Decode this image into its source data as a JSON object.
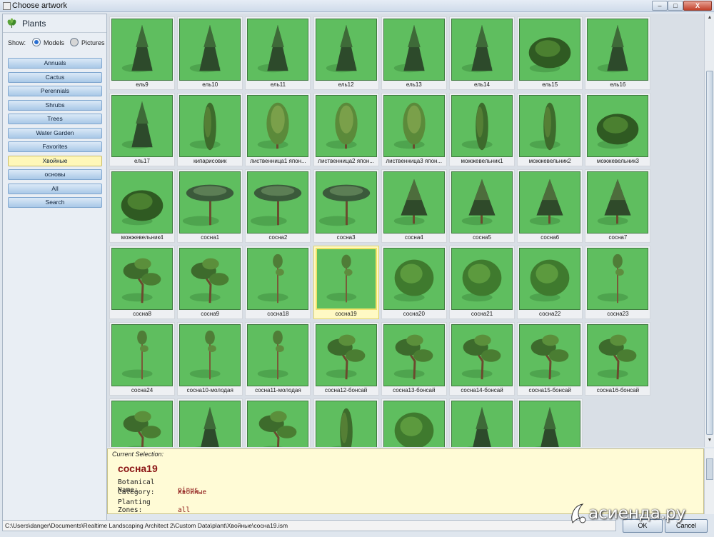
{
  "window": {
    "title": "Choose artwork"
  },
  "titlebar": {
    "minimize": "–",
    "maximize": "□",
    "close": "X"
  },
  "sidebar": {
    "title": "Plants",
    "show_label": "Show:",
    "models_label": "Models",
    "pictures_label": "Pictures",
    "categories": [
      {
        "label": "Annuals"
      },
      {
        "label": "Cactus"
      },
      {
        "label": "Perennials"
      },
      {
        "label": "Shrubs"
      },
      {
        "label": "Trees"
      },
      {
        "label": "Water Garden"
      },
      {
        "label": "Favorites"
      },
      {
        "label": "Хвойные"
      },
      {
        "label": "основы"
      },
      {
        "label": "All"
      },
      {
        "label": "Search"
      }
    ]
  },
  "grid": {
    "items": [
      {
        "label": "ель9",
        "kind": "spruce"
      },
      {
        "label": "ель10",
        "kind": "spruce"
      },
      {
        "label": "ель11",
        "kind": "spruce"
      },
      {
        "label": "ель12",
        "kind": "spruce"
      },
      {
        "label": "ель13",
        "kind": "spruce"
      },
      {
        "label": "ель14",
        "kind": "spruce"
      },
      {
        "label": "ель15",
        "kind": "shrub"
      },
      {
        "label": "ель16",
        "kind": "spruce"
      },
      {
        "label": "ель17",
        "kind": "spruce"
      },
      {
        "label": "кипарисовик",
        "kind": "column"
      },
      {
        "label": "лиственница1 япон...",
        "kind": "weeping"
      },
      {
        "label": "лиственница2 япон...",
        "kind": "weeping"
      },
      {
        "label": "лиственница3 япон...",
        "kind": "weeping"
      },
      {
        "label": "можжевельник1",
        "kind": "column"
      },
      {
        "label": "можжевельник2",
        "kind": "column"
      },
      {
        "label": "можжевельник3",
        "kind": "shrub"
      },
      {
        "label": "можжевельник4",
        "kind": "shrub"
      },
      {
        "label": "сосна1",
        "kind": "umbrella"
      },
      {
        "label": "сосна2",
        "kind": "umbrella"
      },
      {
        "label": "сосна3",
        "kind": "umbrella"
      },
      {
        "label": "сосна4",
        "kind": "cone"
      },
      {
        "label": "сосна5",
        "kind": "cone"
      },
      {
        "label": "сосна6",
        "kind": "cone"
      },
      {
        "label": "сосна7",
        "kind": "cone"
      },
      {
        "label": "сосна8",
        "kind": "bonsai"
      },
      {
        "label": "сосна9",
        "kind": "bonsai"
      },
      {
        "label": "сосна18",
        "kind": "tall"
      },
      {
        "label": "сосна19",
        "kind": "tall"
      },
      {
        "label": "сосна20",
        "kind": "round"
      },
      {
        "label": "сосна21",
        "kind": "round"
      },
      {
        "label": "сосна22",
        "kind": "round"
      },
      {
        "label": "сосна23",
        "kind": "tall"
      },
      {
        "label": "сосна24",
        "kind": "tall"
      },
      {
        "label": "сосна10-молодая",
        "kind": "tall"
      },
      {
        "label": "сосна11-молодая",
        "kind": "tall"
      },
      {
        "label": "сосна12-бонсай",
        "kind": "bonsai"
      },
      {
        "label": "сосна13-бонсай",
        "kind": "bonsai"
      },
      {
        "label": "сосна14-бонсай",
        "kind": "bonsai"
      },
      {
        "label": "сосна15-бонсай",
        "kind": "bonsai"
      },
      {
        "label": "сосна16-бонсай",
        "kind": "bonsai"
      },
      {
        "label": "",
        "kind": "bonsai"
      },
      {
        "label": "",
        "kind": "spruce"
      },
      {
        "label": "",
        "kind": "bonsai"
      },
      {
        "label": "",
        "kind": "column"
      },
      {
        "label": "",
        "kind": "round"
      },
      {
        "label": "",
        "kind": "spruce"
      },
      {
        "label": "",
        "kind": "spruce"
      }
    ],
    "selected_label": "сосна19"
  },
  "details": {
    "current_selection_label": "Current Selection:",
    "name": "сосна19",
    "props": [
      {
        "key": "Botanical Name:",
        "value": "pinus"
      },
      {
        "key": "Category:",
        "value": "Хвойные"
      },
      {
        "key": "Planting Zones:",
        "value": "all"
      }
    ]
  },
  "status": {
    "path": "C:\\Users\\danger\\Documents\\Realtime Landscaping Architect 2\\Custom Data\\plant\\Хвойные\\сосна19.ism"
  },
  "buttons": {
    "ok": "OK",
    "cancel": "Cancel"
  },
  "watermark": "асиенда.ру",
  "colors": {
    "tile_bg": "#5fbe5f",
    "selected": "#fff9c4",
    "accent_text": "#8b1414"
  }
}
